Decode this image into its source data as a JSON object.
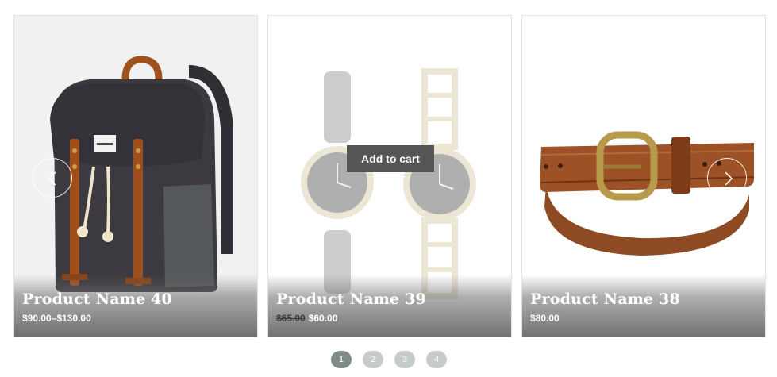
{
  "products": [
    {
      "name": "Product Name 40",
      "price": "$90.00–$130.00",
      "image_icon": "backpack-image"
    },
    {
      "name": "Product Name 39",
      "price_old": "$65.00",
      "price": "$60.00",
      "image_icon": "watches-image",
      "add_to_cart_label": "Add to cart"
    },
    {
      "name": "Product Name 38",
      "price": "$80.00",
      "image_icon": "belt-image"
    }
  ],
  "navigation": {
    "prev_icon": "chevron-left-icon",
    "next_icon": "chevron-right-icon"
  },
  "pagination": {
    "pages": [
      "1",
      "2",
      "3",
      "4"
    ],
    "current": "1"
  },
  "colors": {
    "add_to_cart_bg": "#555555",
    "dot_active": "#7f8b86",
    "dot_inactive": "#c6ccc9"
  }
}
